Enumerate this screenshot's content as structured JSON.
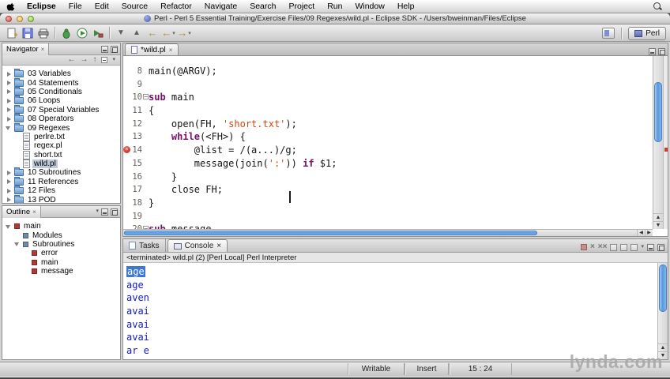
{
  "menubar": {
    "app": "Eclipse",
    "items": [
      "File",
      "Edit",
      "Source",
      "Refactor",
      "Navigate",
      "Search",
      "Project",
      "Run",
      "Window",
      "Help"
    ]
  },
  "titlebar": {
    "title": "Perl - Perl 5 Essential Training/Exercise Files/09 Regexes/wild.pl - Eclipse SDK - /Users/bweinman/Files/Eclipse"
  },
  "toolbar": {
    "perspective_label": "Perl"
  },
  "navigator": {
    "title": "Navigator",
    "items": [
      {
        "label": "03 Variables",
        "type": "folder"
      },
      {
        "label": "04 Statements",
        "type": "folder"
      },
      {
        "label": "05 Conditionals",
        "type": "folder"
      },
      {
        "label": "06 Loops",
        "type": "folder"
      },
      {
        "label": "07 Special Variables",
        "type": "folder"
      },
      {
        "label": "08 Operators",
        "type": "folder"
      },
      {
        "label": "09 Regexes",
        "type": "folder",
        "expanded": true,
        "children": [
          {
            "label": "perlre.txt",
            "type": "file"
          },
          {
            "label": "regex.pl",
            "type": "file"
          },
          {
            "label": "short.txt",
            "type": "file"
          },
          {
            "label": "wild.pl",
            "type": "file",
            "selected": true
          }
        ]
      },
      {
        "label": "10 Subroutines",
        "type": "folder"
      },
      {
        "label": "11 References",
        "type": "folder"
      },
      {
        "label": "12 Files",
        "type": "folder"
      },
      {
        "label": "13 POD",
        "type": "folder"
      }
    ]
  },
  "outline": {
    "title": "Outline",
    "items": [
      {
        "label": "main",
        "type": "module",
        "expanded": true,
        "children": [
          {
            "label": "Modules",
            "type": "group"
          },
          {
            "label": "Subroutines",
            "type": "group",
            "expanded": true,
            "children": [
              {
                "label": "error",
                "type": "sub"
              },
              {
                "label": "main",
                "type": "sub"
              },
              {
                "label": "message",
                "type": "sub"
              }
            ]
          }
        ]
      }
    ]
  },
  "editor": {
    "tab": "*wild.pl",
    "lines": [
      {
        "n": "8",
        "code": [
          [
            "d",
            "main(@ARGV);"
          ]
        ]
      },
      {
        "n": "9",
        "code": []
      },
      {
        "n": "10",
        "fold": true,
        "code": [
          [
            "k",
            "sub"
          ],
          [
            "d",
            " main"
          ]
        ]
      },
      {
        "n": "11",
        "code": [
          [
            "d",
            "{"
          ]
        ]
      },
      {
        "n": "12",
        "code": [
          [
            "d",
            "    open(FH, "
          ],
          [
            "s",
            "'short.txt'"
          ],
          [
            "d",
            ");"
          ]
        ]
      },
      {
        "n": "13",
        "code": [
          [
            "d",
            "    "
          ],
          [
            "k",
            "while"
          ],
          [
            "d",
            "(<FH>) {"
          ]
        ]
      },
      {
        "n": "14",
        "marker": "error",
        "code": [
          [
            "d",
            "        @list = /(a...)/g;"
          ]
        ]
      },
      {
        "n": "15",
        "code": [
          [
            "d",
            "        message(join("
          ],
          [
            "s",
            "':'"
          ],
          [
            "d",
            ")) "
          ],
          [
            "k",
            "if"
          ],
          [
            "d",
            " $1;"
          ]
        ]
      },
      {
        "n": "16",
        "code": [
          [
            "d",
            "    }"
          ]
        ]
      },
      {
        "n": "17",
        "code": [
          [
            "d",
            "    close FH;"
          ]
        ]
      },
      {
        "n": "18",
        "code": [
          [
            "d",
            "}"
          ]
        ]
      },
      {
        "n": "19",
        "code": []
      },
      {
        "n": "20",
        "fold": true,
        "code": [
          [
            "k",
            "sub"
          ],
          [
            "d",
            " message"
          ]
        ]
      }
    ]
  },
  "console": {
    "tabs": [
      "Tasks",
      "Console"
    ],
    "status": "<terminated> wild.pl (2) [Perl Local] Perl Interpreter",
    "selected_line": 0,
    "output": [
      "age",
      "age",
      "aven",
      "avai",
      "avai",
      "avai",
      "ar e"
    ]
  },
  "statusbar": {
    "writable": "Writable",
    "insert_mode": "Insert",
    "cursor_position": "15 : 24"
  },
  "watermark": "lynda.com",
  "icons": {
    "close": "×",
    "minus": "−",
    "back": "←",
    "forward": "→",
    "up": "↑",
    "menu": "▾",
    "tri_up": "▲",
    "tri_down": "▼",
    "tri_left": "◀",
    "tri_right": "▶"
  }
}
